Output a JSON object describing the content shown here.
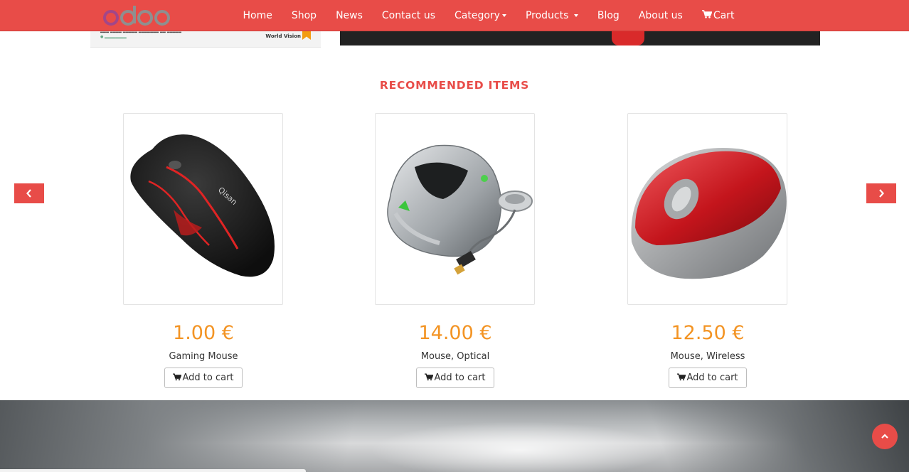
{
  "nav": {
    "logo_text": "odoo",
    "items": [
      {
        "label": "Home",
        "dropdown": false
      },
      {
        "label": "Shop",
        "dropdown": false
      },
      {
        "label": "News",
        "dropdown": false
      },
      {
        "label": "Contact us",
        "dropdown": false
      },
      {
        "label": "Category",
        "dropdown": true
      },
      {
        "label": "Products",
        "dropdown": true
      },
      {
        "label": "Blog",
        "dropdown": false
      },
      {
        "label": "About us",
        "dropdown": false
      },
      {
        "label": "Cart",
        "dropdown": false,
        "icon": "cart-icon"
      }
    ]
  },
  "banner": {
    "brand": "World Vision"
  },
  "recommended": {
    "title": "RECOMMENDED ITEMS",
    "prev_icon": "chevron-left-icon",
    "next_icon": "chevron-right-icon",
    "products": [
      {
        "name": "Gaming Mouse",
        "price": "1.00 €",
        "button": "Add to cart"
      },
      {
        "name": "Mouse, Optical",
        "price": "14.00 €",
        "button": "Add to cart"
      },
      {
        "name": "Mouse, Wireless",
        "price": "12.50 €",
        "button": "Add to cart"
      }
    ]
  },
  "colors": {
    "accent": "#e84c48",
    "price": "#f39424"
  },
  "back_to_top_icon": "chevron-up-icon"
}
